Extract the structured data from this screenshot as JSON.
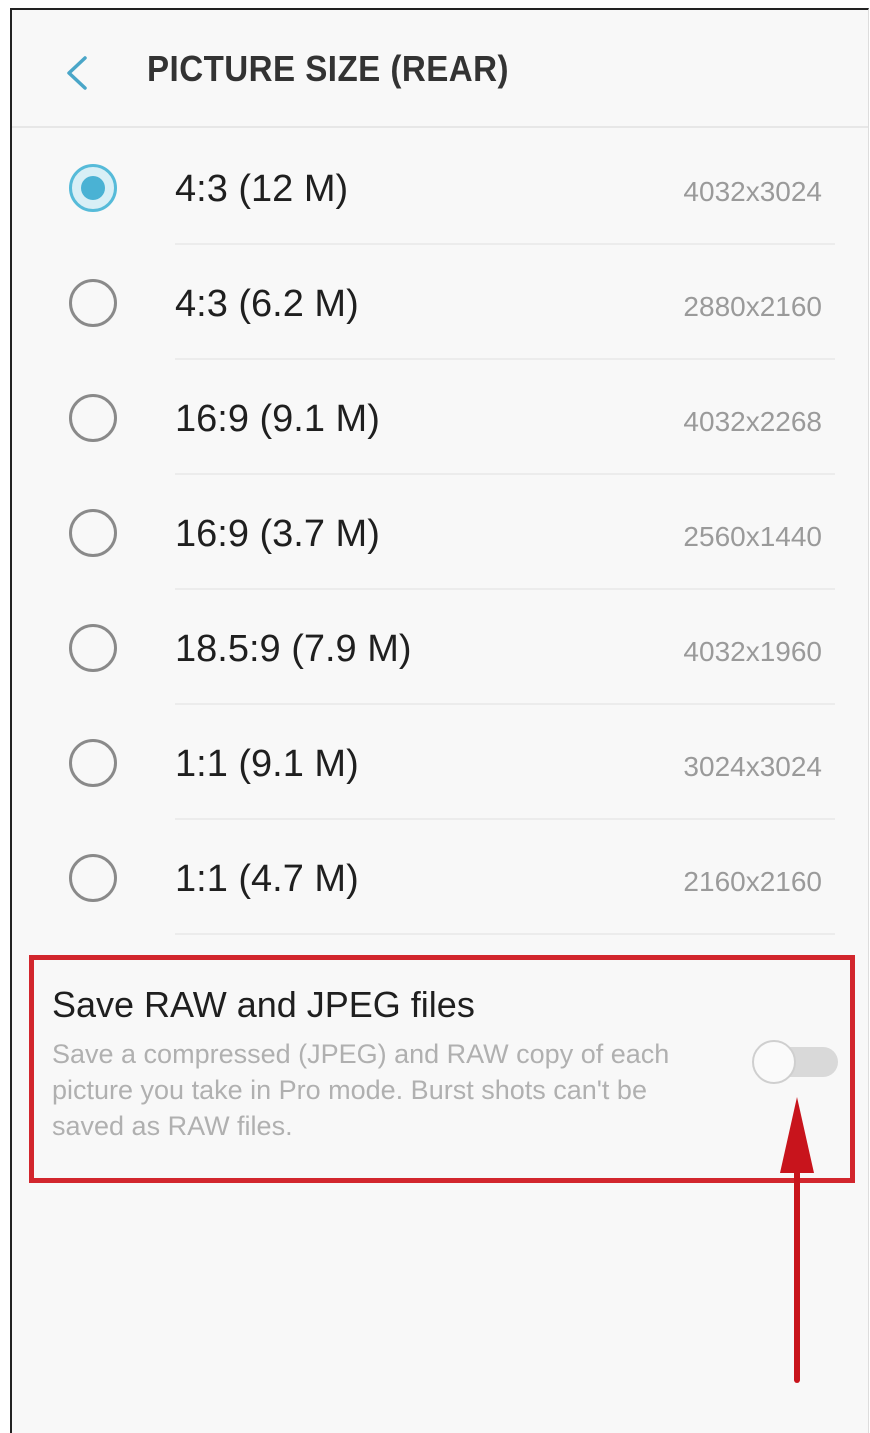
{
  "header": {
    "title": "PICTURE SIZE (REAR)",
    "back_icon": "chevron-left-icon"
  },
  "options": [
    {
      "label": "4:3 (12 M)",
      "resolution": "4032x3024",
      "selected": true
    },
    {
      "label": "4:3 (6.2 M)",
      "resolution": "2880x2160",
      "selected": false
    },
    {
      "label": "16:9 (9.1 M)",
      "resolution": "4032x2268",
      "selected": false
    },
    {
      "label": "16:9 (3.7 M)",
      "resolution": "2560x1440",
      "selected": false
    },
    {
      "label": "18.5:9 (7.9 M)",
      "resolution": "4032x1960",
      "selected": false
    },
    {
      "label": "1:1 (9.1 M)",
      "resolution": "3024x3024",
      "selected": false
    },
    {
      "label": "1:1 (4.7 M)",
      "resolution": "2160x2160",
      "selected": false
    }
  ],
  "raw_setting": {
    "title": "Save RAW and JPEG files",
    "description": "Save a compressed (JPEG) and RAW copy of each picture you take in Pro mode. Burst shots can't be saved as RAW files.",
    "enabled": false
  },
  "colors": {
    "accent": "#4ab2d4",
    "highlight_box": "#d2262d"
  }
}
